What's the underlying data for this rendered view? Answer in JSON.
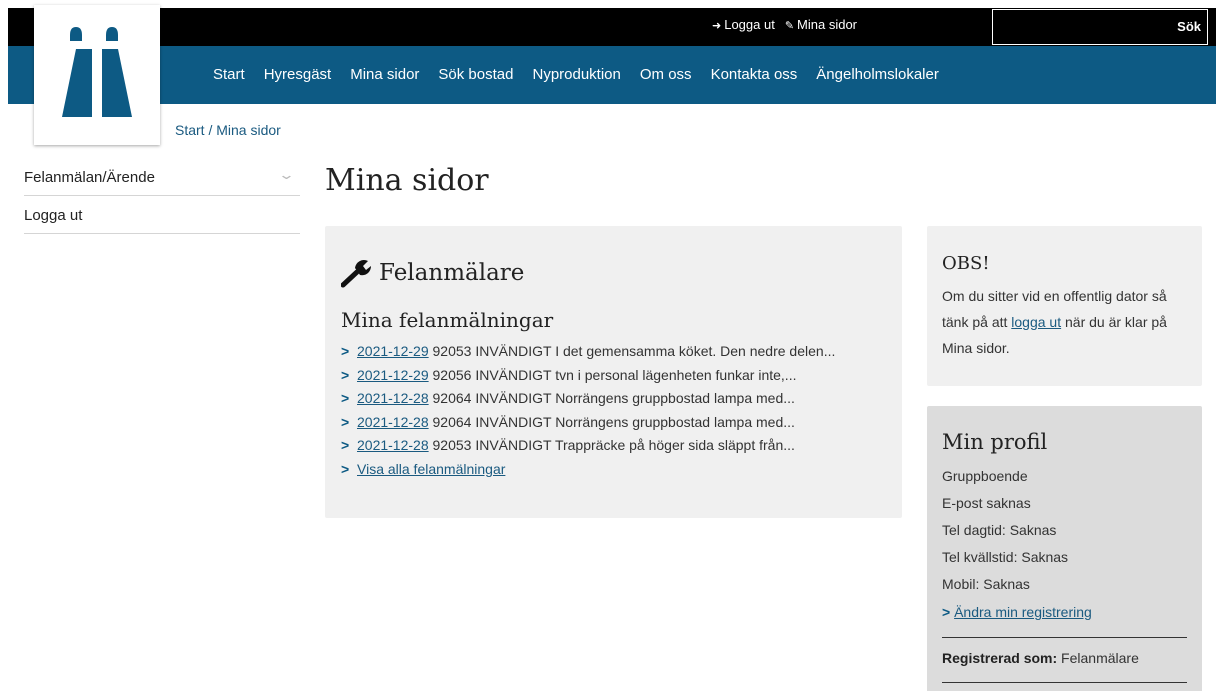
{
  "topbar": {
    "logout_label": "Logga ut",
    "mypages_label": "Mina sidor",
    "search_placeholder": "",
    "search_button": "Sök"
  },
  "nav": {
    "items": [
      "Start",
      "Hyresgäst",
      "Mina sidor",
      "Sök bostad",
      "Nyproduktion",
      "Om oss",
      "Kontakta oss",
      "Ängelholmslokaler"
    ]
  },
  "breadcrumb": {
    "start": "Start",
    "separator": "/",
    "current": "Mina sidor"
  },
  "sidebar": {
    "items": [
      "Felanmälan/Ärende",
      "Logga ut"
    ]
  },
  "page_title": "Mina sidor",
  "felanmalare": {
    "heading": "Felanmälare",
    "subheading": "Mina felanmälningar",
    "reports": [
      {
        "date": "2021-12-29",
        "text": "92053 INVÄNDIGT I det gemensamma köket. Den nedre delen..."
      },
      {
        "date": "2021-12-29",
        "text": "92056 INVÄNDIGT tvn i personal lägenheten funkar inte,..."
      },
      {
        "date": "2021-12-28",
        "text": "92064 INVÄNDIGT Norrängens gruppbostad lampa med..."
      },
      {
        "date": "2021-12-28",
        "text": "92064 INVÄNDIGT Norrängens gruppbostad lampa med..."
      },
      {
        "date": "2021-12-28",
        "text": "92053 INVÄNDIGT Trappräcke på höger sida släppt från..."
      }
    ],
    "show_all": "Visa alla felanmälningar"
  },
  "obs": {
    "heading": "OBS!",
    "text_before": "Om du sitter vid en offentlig dator så tänk på att ",
    "link": "logga ut",
    "text_after": " när du är klar på Mina sidor."
  },
  "profile": {
    "heading": "Min profil",
    "rows": [
      "Gruppboende",
      "E-post saknas",
      "Tel dagtid: Saknas",
      "Tel kvällstid: Saknas",
      "Mobil: Saknas"
    ],
    "change_link": "Ändra min registrering",
    "registered_label": "Registrerad som:",
    "registered_value": "Felanmälare"
  },
  "colors": {
    "nav_blue": "#0d5a84",
    "link_blue": "#1a5a80",
    "panel_gray": "#f0f0f0",
    "profile_gray": "#dcdcdc"
  }
}
